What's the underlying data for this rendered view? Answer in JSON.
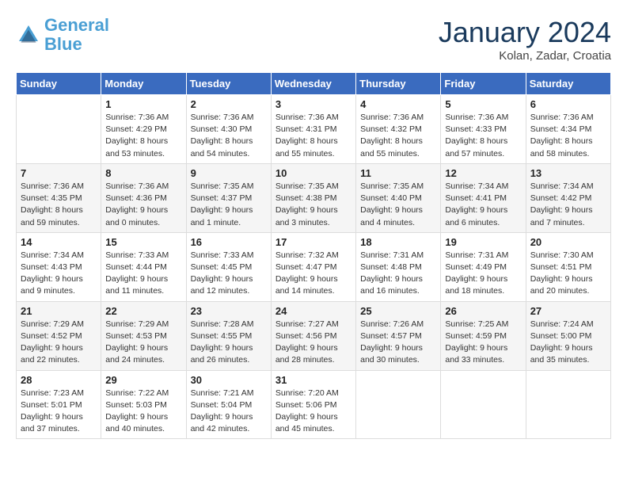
{
  "header": {
    "logo_line1": "General",
    "logo_line2": "Blue",
    "month_title": "January 2024",
    "location": "Kolan, Zadar, Croatia"
  },
  "weekdays": [
    "Sunday",
    "Monday",
    "Tuesday",
    "Wednesday",
    "Thursday",
    "Friday",
    "Saturday"
  ],
  "weeks": [
    [
      {
        "num": "",
        "info": ""
      },
      {
        "num": "1",
        "info": "Sunrise: 7:36 AM\nSunset: 4:29 PM\nDaylight: 8 hours\nand 53 minutes."
      },
      {
        "num": "2",
        "info": "Sunrise: 7:36 AM\nSunset: 4:30 PM\nDaylight: 8 hours\nand 54 minutes."
      },
      {
        "num": "3",
        "info": "Sunrise: 7:36 AM\nSunset: 4:31 PM\nDaylight: 8 hours\nand 55 minutes."
      },
      {
        "num": "4",
        "info": "Sunrise: 7:36 AM\nSunset: 4:32 PM\nDaylight: 8 hours\nand 55 minutes."
      },
      {
        "num": "5",
        "info": "Sunrise: 7:36 AM\nSunset: 4:33 PM\nDaylight: 8 hours\nand 57 minutes."
      },
      {
        "num": "6",
        "info": "Sunrise: 7:36 AM\nSunset: 4:34 PM\nDaylight: 8 hours\nand 58 minutes."
      }
    ],
    [
      {
        "num": "7",
        "info": "Sunrise: 7:36 AM\nSunset: 4:35 PM\nDaylight: 8 hours\nand 59 minutes."
      },
      {
        "num": "8",
        "info": "Sunrise: 7:36 AM\nSunset: 4:36 PM\nDaylight: 9 hours\nand 0 minutes."
      },
      {
        "num": "9",
        "info": "Sunrise: 7:35 AM\nSunset: 4:37 PM\nDaylight: 9 hours\nand 1 minute."
      },
      {
        "num": "10",
        "info": "Sunrise: 7:35 AM\nSunset: 4:38 PM\nDaylight: 9 hours\nand 3 minutes."
      },
      {
        "num": "11",
        "info": "Sunrise: 7:35 AM\nSunset: 4:40 PM\nDaylight: 9 hours\nand 4 minutes."
      },
      {
        "num": "12",
        "info": "Sunrise: 7:34 AM\nSunset: 4:41 PM\nDaylight: 9 hours\nand 6 minutes."
      },
      {
        "num": "13",
        "info": "Sunrise: 7:34 AM\nSunset: 4:42 PM\nDaylight: 9 hours\nand 7 minutes."
      }
    ],
    [
      {
        "num": "14",
        "info": "Sunrise: 7:34 AM\nSunset: 4:43 PM\nDaylight: 9 hours\nand 9 minutes."
      },
      {
        "num": "15",
        "info": "Sunrise: 7:33 AM\nSunset: 4:44 PM\nDaylight: 9 hours\nand 11 minutes."
      },
      {
        "num": "16",
        "info": "Sunrise: 7:33 AM\nSunset: 4:45 PM\nDaylight: 9 hours\nand 12 minutes."
      },
      {
        "num": "17",
        "info": "Sunrise: 7:32 AM\nSunset: 4:47 PM\nDaylight: 9 hours\nand 14 minutes."
      },
      {
        "num": "18",
        "info": "Sunrise: 7:31 AM\nSunset: 4:48 PM\nDaylight: 9 hours\nand 16 minutes."
      },
      {
        "num": "19",
        "info": "Sunrise: 7:31 AM\nSunset: 4:49 PM\nDaylight: 9 hours\nand 18 minutes."
      },
      {
        "num": "20",
        "info": "Sunrise: 7:30 AM\nSunset: 4:51 PM\nDaylight: 9 hours\nand 20 minutes."
      }
    ],
    [
      {
        "num": "21",
        "info": "Sunrise: 7:29 AM\nSunset: 4:52 PM\nDaylight: 9 hours\nand 22 minutes."
      },
      {
        "num": "22",
        "info": "Sunrise: 7:29 AM\nSunset: 4:53 PM\nDaylight: 9 hours\nand 24 minutes."
      },
      {
        "num": "23",
        "info": "Sunrise: 7:28 AM\nSunset: 4:55 PM\nDaylight: 9 hours\nand 26 minutes."
      },
      {
        "num": "24",
        "info": "Sunrise: 7:27 AM\nSunset: 4:56 PM\nDaylight: 9 hours\nand 28 minutes."
      },
      {
        "num": "25",
        "info": "Sunrise: 7:26 AM\nSunset: 4:57 PM\nDaylight: 9 hours\nand 30 minutes."
      },
      {
        "num": "26",
        "info": "Sunrise: 7:25 AM\nSunset: 4:59 PM\nDaylight: 9 hours\nand 33 minutes."
      },
      {
        "num": "27",
        "info": "Sunrise: 7:24 AM\nSunset: 5:00 PM\nDaylight: 9 hours\nand 35 minutes."
      }
    ],
    [
      {
        "num": "28",
        "info": "Sunrise: 7:23 AM\nSunset: 5:01 PM\nDaylight: 9 hours\nand 37 minutes."
      },
      {
        "num": "29",
        "info": "Sunrise: 7:22 AM\nSunset: 5:03 PM\nDaylight: 9 hours\nand 40 minutes."
      },
      {
        "num": "30",
        "info": "Sunrise: 7:21 AM\nSunset: 5:04 PM\nDaylight: 9 hours\nand 42 minutes."
      },
      {
        "num": "31",
        "info": "Sunrise: 7:20 AM\nSunset: 5:06 PM\nDaylight: 9 hours\nand 45 minutes."
      },
      {
        "num": "",
        "info": ""
      },
      {
        "num": "",
        "info": ""
      },
      {
        "num": "",
        "info": ""
      }
    ]
  ]
}
